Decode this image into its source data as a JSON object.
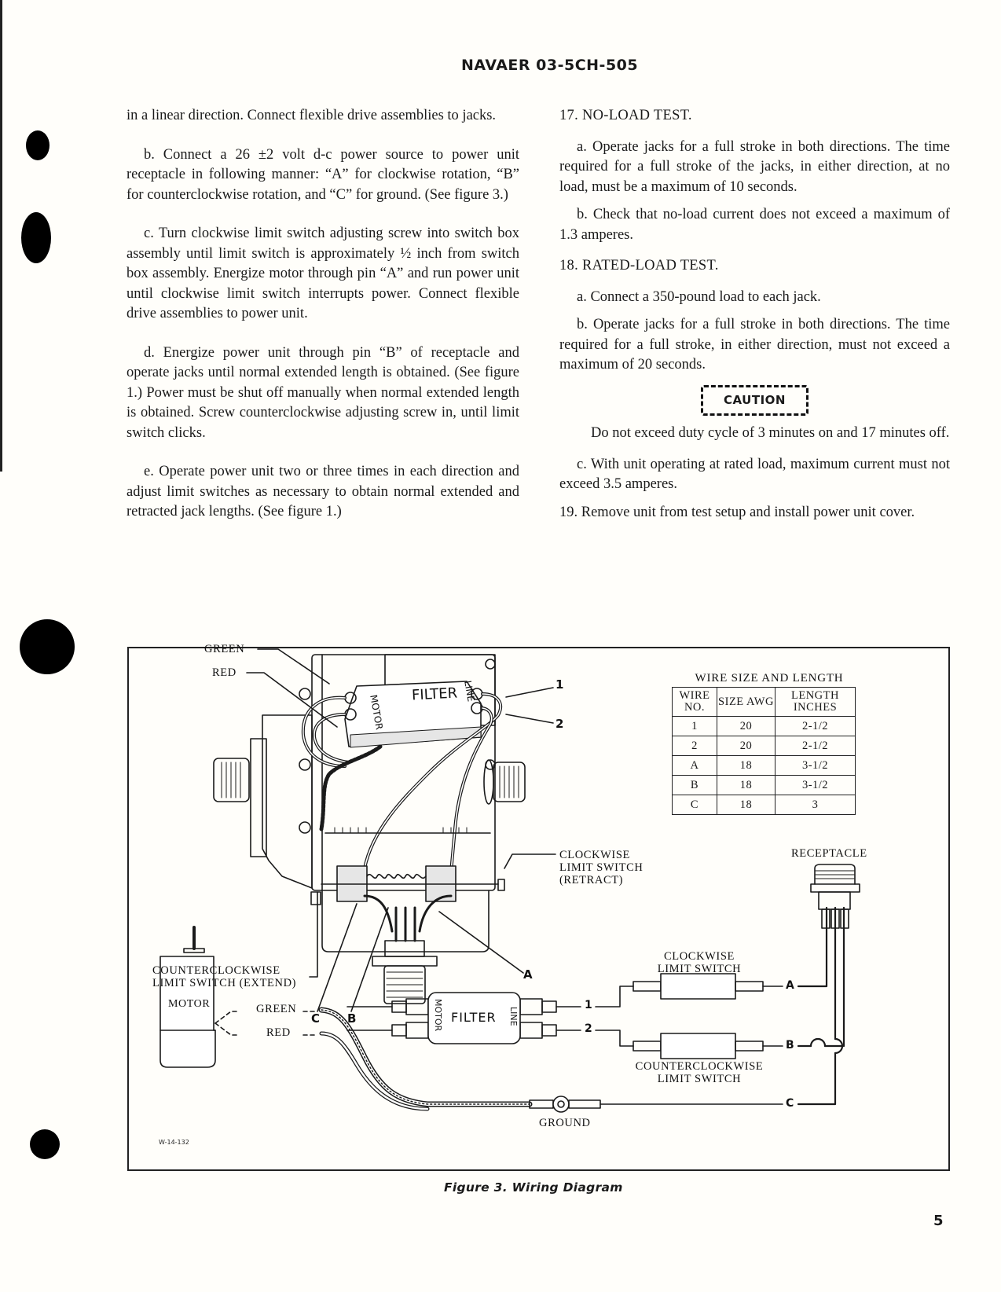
{
  "header": {
    "document_number": "NAVAER 03-5CH-505"
  },
  "left_column": {
    "continuation": "in a linear direction. Connect flexible drive assemblies to jacks.",
    "step_b": "b. Connect a 26 ±2 volt d-c power source to power unit receptacle in following manner: “A” for clockwise rotation, “B” for counterclockwise rotation, and “C” for ground. (See figure 3.)",
    "step_c": "c. Turn clockwise limit switch adjusting screw into switch box assembly until limit switch is approximately ½ inch from switch box assembly. Energize motor through pin “A” and run power unit until clockwise limit switch interrupts power. Connect flexible drive assemblies to power unit.",
    "step_d": "d. Energize power unit through pin “B” of receptacle and operate jacks until normal extended length is obtained. (See figure 1.) Power must be shut off manually when normal extended length is obtained. Screw counterclockwise adjusting screw in, until limit switch clicks.",
    "step_e": "e. Operate power unit two or three times in each direction and adjust limit switches as necessary to obtain normal extended and retracted jack lengths. (See figure 1.)"
  },
  "right_column": {
    "section_17": {
      "heading": "17. NO-LOAD TEST.",
      "step_a": "a. Operate jacks for a full stroke in both directions. The time required for a full stroke of the jacks, in either direction, at no load, must be a maximum of 10 seconds.",
      "step_b": "b. Check that no-load current does not exceed a maximum of 1.3 amperes."
    },
    "section_18": {
      "heading": "18. RATED-LOAD TEST.",
      "step_a": "a. Connect a 350-pound load to each jack.",
      "step_b": "b. Operate jacks for a full stroke in both directions. The time required for a full stroke, in either direction, must not exceed a maximum of 20 seconds.",
      "caution_label": "CAUTION",
      "caution_text": "Do not exceed duty cycle of 3 minutes on and 17 minutes off.",
      "step_c": "c. With unit operating at rated load, maximum current must not exceed 3.5 amperes."
    },
    "section_19": {
      "text": "19. Remove unit from test setup and install power unit cover."
    }
  },
  "figure": {
    "caption": "Figure 3.  Wiring Diagram",
    "drawing_id": "W-14-132",
    "callouts": {
      "green": "GREEN",
      "red": "RED",
      "wire_1": "1",
      "wire_2": "2",
      "filter": "FILTER",
      "motor_side": "MOTOR",
      "line_side": "LINE",
      "cw_switch_line1": "CLOCKWISE",
      "cw_switch_line2": "LIMIT SWITCH",
      "cw_switch_line3": "(RETRACT)",
      "ccw_switch_line1": "COUNTERCLOCKWISE",
      "ccw_switch_line2": "LIMIT SWITCH (EXTEND)",
      "pin_a": "A",
      "pin_b": "B",
      "pin_c": "C",
      "receptacle": "RECEPTACLE"
    },
    "schematic": {
      "motor": "MOTOR",
      "green": "GREEN",
      "red": "RED",
      "filter": "FILTER",
      "filter_motor": "MOTOR",
      "filter_line": "LINE",
      "wire_1": "1",
      "wire_2": "2",
      "cw_switch_line1": "CLOCKWISE",
      "cw_switch_line2": "LIMIT SWITCH",
      "ccw_switch_line1": "COUNTERCLOCKWISE",
      "ccw_switch_line2": "LIMIT SWITCH",
      "pin_a": "A",
      "pin_b": "B",
      "pin_c": "C",
      "ground": "GROUND"
    },
    "wire_table": {
      "title": "WIRE SIZE AND LENGTH",
      "headers": [
        "WIRE NO.",
        "SIZE AWG",
        "LENGTH INCHES"
      ],
      "rows": [
        [
          "1",
          "20",
          "2-1/2"
        ],
        [
          "2",
          "20",
          "2-1/2"
        ],
        [
          "A",
          "18",
          "3-1/2"
        ],
        [
          "B",
          "18",
          "3-1/2"
        ],
        [
          "C",
          "18",
          "3"
        ]
      ]
    }
  },
  "footer": {
    "page_number": "5"
  }
}
